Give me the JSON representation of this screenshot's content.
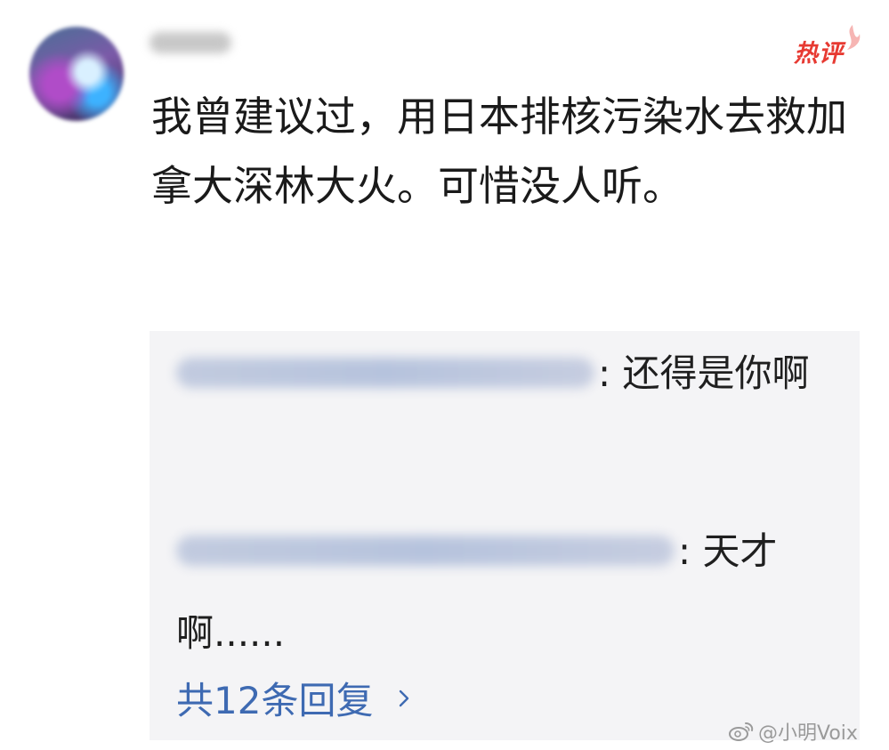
{
  "comment": {
    "badge": "热评",
    "text": "我曾建议过，用日本排核污染水去救加拿大深林大火。可惜没人听。"
  },
  "replies": [
    {
      "text": ": 还得是你啊"
    },
    {
      "text": ": 天才啊......"
    }
  ],
  "more_replies": {
    "label": "共12条回复"
  },
  "watermark": {
    "text": "@小明Voix"
  },
  "colors": {
    "badge": "#e73a32",
    "link": "#3e6ab2",
    "reply_bg": "#f4f4f6"
  }
}
